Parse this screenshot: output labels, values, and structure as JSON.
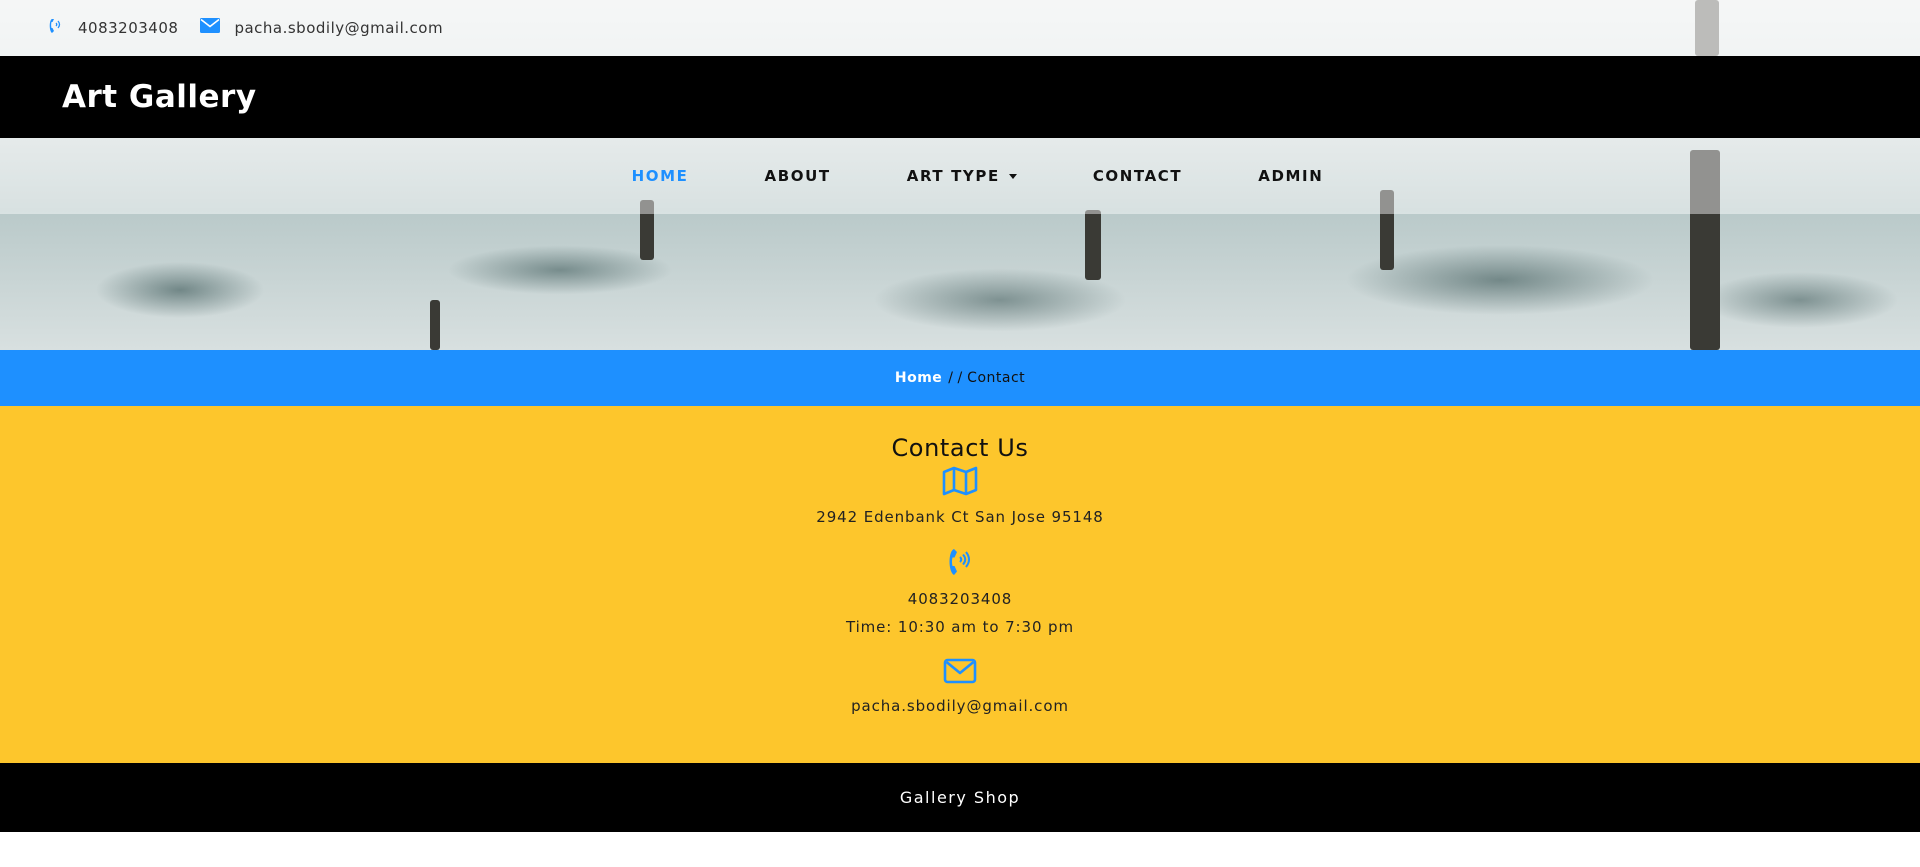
{
  "topbar": {
    "phone": "4083203408",
    "email": "pacha.sbodily@gmail.com",
    "phone_icon": "phone-volume-icon",
    "email_icon": "envelope-icon"
  },
  "brand": {
    "title": "Art Gallery"
  },
  "nav": {
    "items": [
      {
        "label": "HOME",
        "active": true
      },
      {
        "label": "ABOUT"
      },
      {
        "label": "ART TYPE",
        "dropdown": true
      },
      {
        "label": "CONTACT"
      },
      {
        "label": "ADMIN"
      }
    ]
  },
  "breadcrumb": {
    "home": "Home",
    "separator": "/ /",
    "current": "Contact"
  },
  "contact": {
    "heading": "Contact Us",
    "address": "2942 Edenbank Ct San Jose 95148",
    "phone": "4083203408",
    "hours": "Time: 10:30 am to 7:30 pm",
    "email": "pacha.sbodily@gmail.com",
    "icons": [
      "map-icon",
      "phone-volume-icon",
      "envelope-icon"
    ]
  },
  "footer": {
    "text": "Gallery Shop"
  },
  "colors": {
    "accent": "#1e90ff",
    "contact_bg": "#fdc62c",
    "dark": "#000000"
  }
}
